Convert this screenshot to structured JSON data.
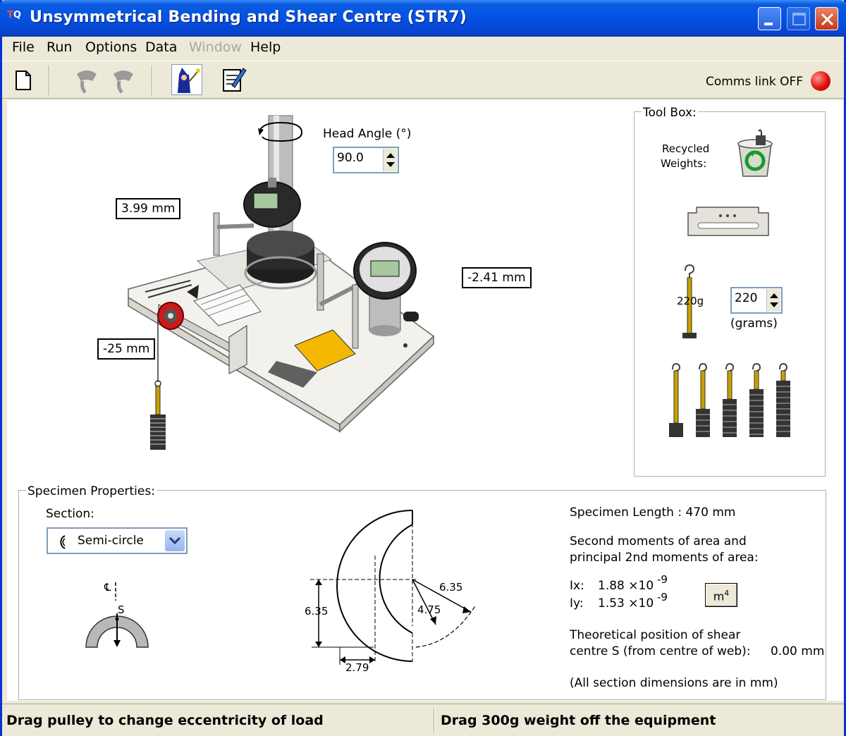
{
  "window": {
    "title": "Unsymmetrical Bending and Shear Centre (STR7)",
    "icon": "tecquipment-logo-icon"
  },
  "menu": [
    {
      "label": "File",
      "enabled": true
    },
    {
      "label": "Run",
      "enabled": true
    },
    {
      "label": "Options",
      "enabled": true
    },
    {
      "label": "Data",
      "enabled": true
    },
    {
      "label": "Window",
      "enabled": false
    },
    {
      "label": "Help",
      "enabled": true
    }
  ],
  "toolbar": {
    "icons": [
      "new-document-icon",
      "connect-icon",
      "disconnect-icon",
      "wizard-icon",
      "notes-icon"
    ],
    "comms_label": "Comms link OFF",
    "comms_status_color": "#E01010"
  },
  "apparatus": {
    "head_angle_label": "Head Angle (°)",
    "head_angle_value": "90.0",
    "left_gauge_reading": "3.99 mm",
    "right_gauge_reading": "-2.41 mm",
    "pulley_position": "-25 mm"
  },
  "toolbox": {
    "label": "Tool Box:",
    "recycled_label_1": "Recycled",
    "recycled_label_2": "Weights:",
    "hanger_label": "220g",
    "grams_value": "220",
    "grams_unit": "(grams)"
  },
  "specimen": {
    "label": "Specimen Properties:",
    "section_label": "Section:",
    "section_value": "Semi-circle",
    "centreline_label": "℄",
    "shear_label": "S",
    "dims": {
      "d1": "6.35",
      "d2": "6.35",
      "d3": "4.75",
      "d4": "2.79"
    },
    "length_text": "Specimen Length : 470 mm",
    "moments_line1": "Second moments of area and",
    "moments_line2": "principal 2nd moments of area:",
    "ix_label": "Ix:",
    "ix_value": "1.88 ×10",
    "ix_exp": "-9",
    "iy_label": "Iy:",
    "iy_value": "1.53 ×10",
    "iy_exp": "-9",
    "units_button": "m",
    "units_exp": "4",
    "shear_line1": "Theoretical position of shear",
    "shear_line2": "centre S (from centre of web):",
    "shear_value": "0.00 mm",
    "note": "(All section dimensions are in mm)"
  },
  "statusbar": {
    "left": "Drag pulley to change eccentricity of load",
    "right": "Drag 300g weight off the equipment"
  }
}
